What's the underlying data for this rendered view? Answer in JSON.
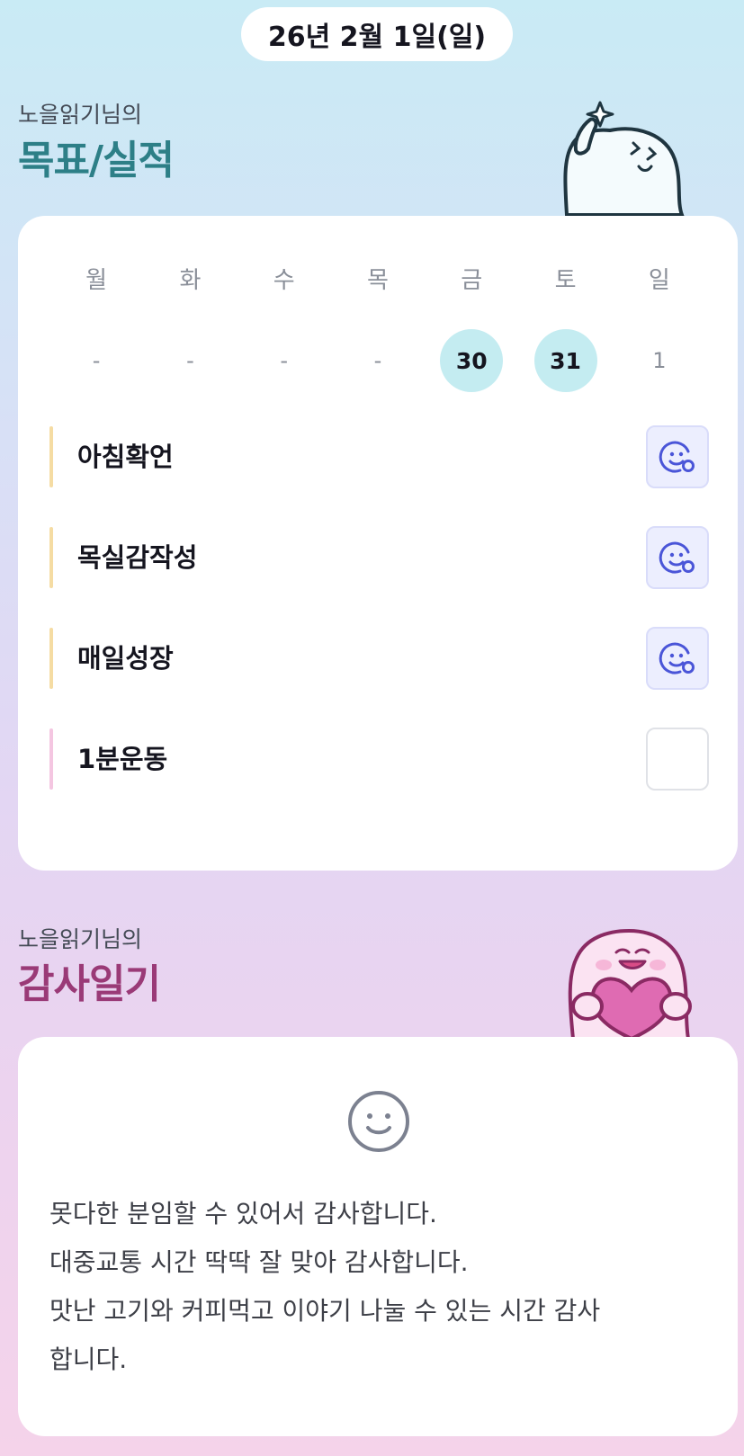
{
  "date_label": "26년 2월 1일(일)",
  "goals_section": {
    "owner": "노을읽기님의",
    "title": "목표/실적",
    "week": [
      {
        "day": "월",
        "date": "-",
        "active": false
      },
      {
        "day": "화",
        "date": "-",
        "active": false
      },
      {
        "day": "수",
        "date": "-",
        "active": false
      },
      {
        "day": "목",
        "date": "-",
        "active": false
      },
      {
        "day": "금",
        "date": "30",
        "active": true
      },
      {
        "day": "토",
        "date": "31",
        "active": true
      },
      {
        "day": "일",
        "date": "1",
        "active": false
      }
    ],
    "goals": [
      {
        "label": "아침확언",
        "completed": true,
        "accent": "#f5dca3"
      },
      {
        "label": "목실감작성",
        "completed": true,
        "accent": "#f5dca3"
      },
      {
        "label": "매일성장",
        "completed": true,
        "accent": "#f5dca3"
      },
      {
        "label": "1분운동",
        "completed": false,
        "accent": "#f4c6e1"
      }
    ]
  },
  "gratitude_section": {
    "owner": "노을읽기님의",
    "title": "감사일기",
    "entries": [
      "못다한 분임할 수 있어서 감사합니다.",
      "대중교통 시간 딱딱 잘 맞아 감사합니다.",
      "맛난 고기와 커피먹고 이야기 나눌 수 있는 시간 감사",
      "합니다."
    ]
  },
  "colors": {
    "goals_title": "#2d7f87",
    "gratitude_title": "#9a3a77",
    "active_date_bg": "#c4ecf1",
    "check_done_bg": "#eceefe",
    "check_icon": "#4a55d8"
  },
  "icons": {
    "check_done": "smile-badge-icon",
    "diary": "smile-icon",
    "mascot_top": "waving-ghost-mascot",
    "mascot_bottom": "heart-holding-ghost-mascot"
  }
}
